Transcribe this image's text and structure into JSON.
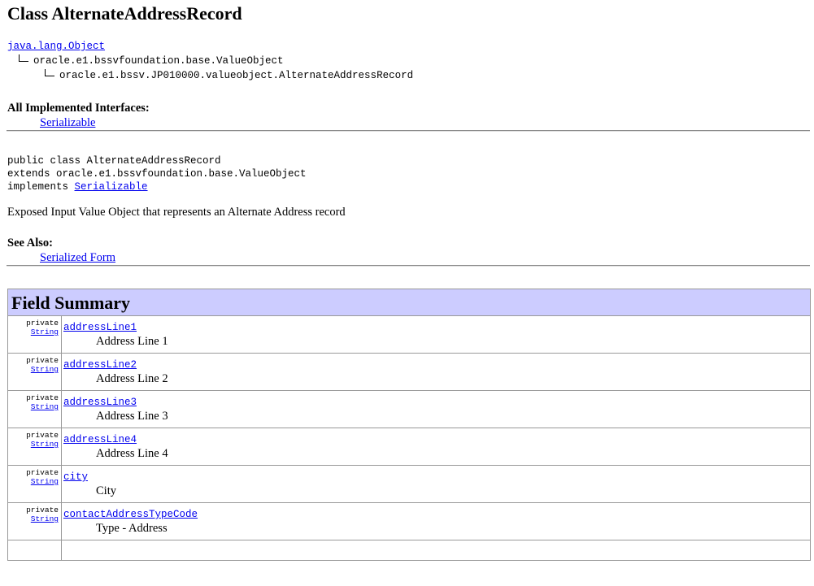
{
  "title": "Class AlternateAddressRecord",
  "hierarchy": {
    "level1": "java.lang.Object",
    "level2": "oracle.e1.bssvfoundation.base.ValueObject",
    "level3": "oracle.e1.bssv.JP010000.valueobject.AlternateAddressRecord"
  },
  "interfaces": {
    "label": "All Implemented Interfaces:",
    "items": [
      "Serializable"
    ]
  },
  "declaration": {
    "line1": "public class AlternateAddressRecord",
    "line2": "extends oracle.e1.bssvfoundation.base.ValueObject",
    "line3_prefix": "implements ",
    "line3_link": "Serializable"
  },
  "description": "Exposed Input Value Object that represents an Alternate Address record",
  "see_also": {
    "label": "See Also:",
    "link": "Serialized Form"
  },
  "field_summary": {
    "heading": "Field Summary",
    "rows": [
      {
        "modifier": "private",
        "type": "String",
        "name": "addressLine1",
        "desc": "Address Line 1"
      },
      {
        "modifier": "private",
        "type": "String",
        "name": "addressLine2",
        "desc": "Address Line 2"
      },
      {
        "modifier": "private",
        "type": "String",
        "name": "addressLine3",
        "desc": "Address Line 3"
      },
      {
        "modifier": "private",
        "type": "String",
        "name": "addressLine4",
        "desc": "Address Line 4"
      },
      {
        "modifier": "private",
        "type": "String",
        "name": "city",
        "desc": "City"
      },
      {
        "modifier": "private",
        "type": "String",
        "name": "contactAddressTypeCode",
        "desc": "Type - Address"
      }
    ]
  }
}
